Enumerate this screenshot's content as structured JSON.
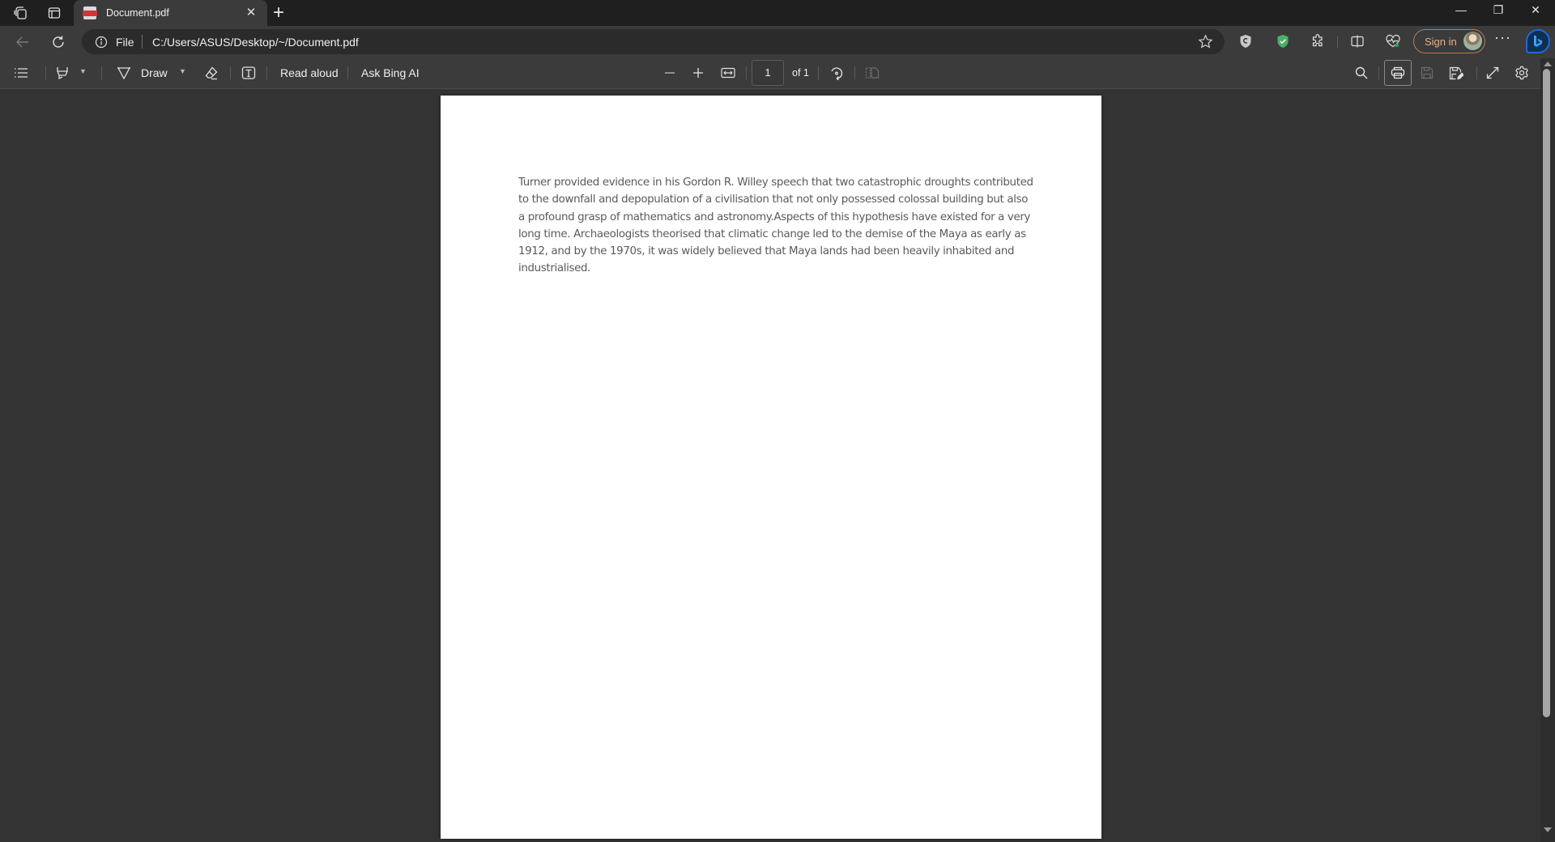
{
  "browser": {
    "tab": {
      "title": "Document.pdf",
      "icon": "pdf-file-icon"
    },
    "address": {
      "scheme_label": "File",
      "url": "C:/Users/ASUS/Desktop/~/Document.pdf"
    },
    "sign_in_label": "Sign in",
    "window_controls": {
      "minimize": "—",
      "restore": "❐",
      "close": "✕"
    },
    "new_tab_label": "+",
    "more_label": "···"
  },
  "pdf_toolbar": {
    "draw_label": "Draw",
    "read_aloud_label": "Read aloud",
    "ask_bing_label": "Ask Bing AI",
    "current_page": "1",
    "page_count_label": "of 1"
  },
  "document": {
    "paragraph": "Turner provided evidence in his Gordon R. Willey speech that two catastrophic droughts contributed to the downfall and depopulation of a civilisation that not only possessed colossal building but also a profound grasp of mathematics and astronomy.Aspects of this hypothesis have existed for a very long time. Archaeologists theorised that climatic change led to the demise of the Maya as early as 1912, and by the 1970s, it was widely believed that Maya lands had been heavily inhabited and industrialised."
  },
  "scroll": {
    "visible_fraction": 0.85
  }
}
